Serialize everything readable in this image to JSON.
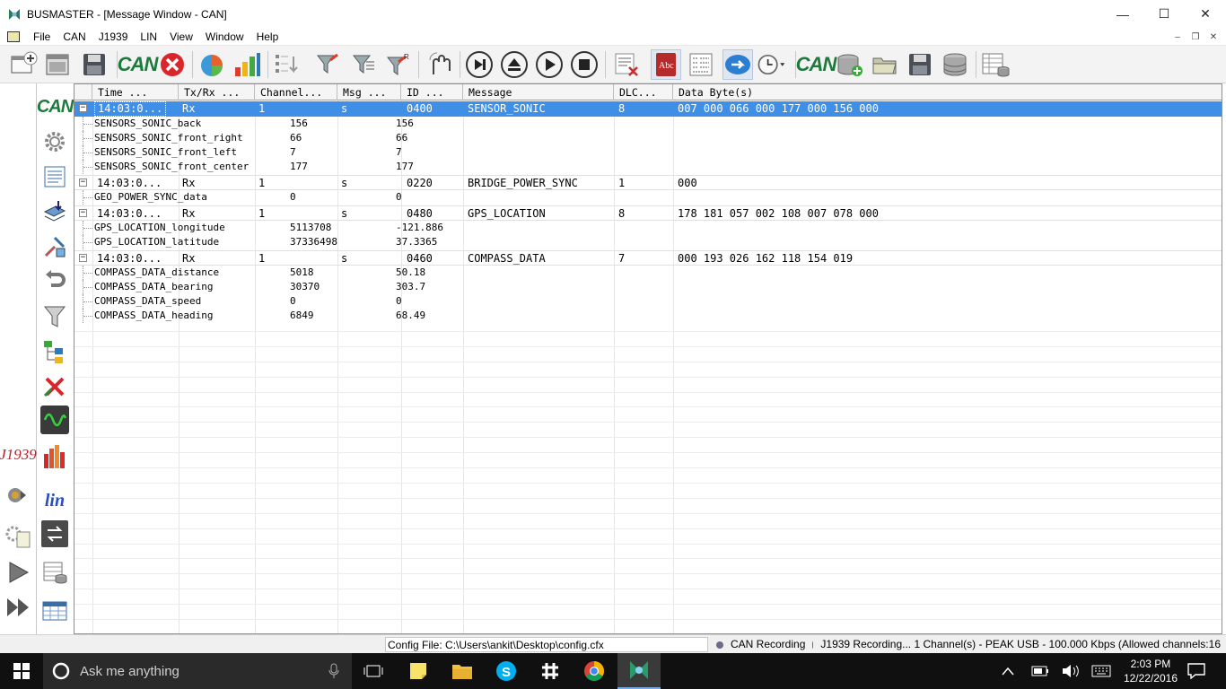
{
  "window": {
    "title": "BUSMASTER - [Message Window - CAN]",
    "minimize": "—",
    "maximize": "☐",
    "close": "✕"
  },
  "menu": [
    "File",
    "CAN",
    "J1939",
    "LIN",
    "View",
    "Window",
    "Help"
  ],
  "mdi_buttons": [
    "–",
    "❐",
    "✕"
  ],
  "toolbar": {
    "can_label_1": "CAN",
    "can_label_2": "CAN",
    "spell_label": "Abc",
    "filter_r_label": "R"
  },
  "sidebar": {
    "can_label": "CAN",
    "j1939_label": "J1939",
    "lin_label": "lin"
  },
  "columns": [
    "Time   ...",
    "Tx/Rx  ...",
    "Channel...",
    "Msg ...",
    "ID   ...",
    "Message",
    "DLC...",
    "Data Byte(s)"
  ],
  "messages": [
    {
      "time": "14:03:0...",
      "txrx": "Rx",
      "channel": "1",
      "type": "s",
      "id": "0400",
      "name": "SENSOR_SONIC",
      "dlc": "8",
      "data": "007 000 066 000 177 000 156 000",
      "selected": true,
      "signals": [
        {
          "name": "SENSORS_SONIC_back",
          "raw": "156",
          "phys": "156"
        },
        {
          "name": "SENSORS_SONIC_front_right",
          "raw": "66",
          "phys": "66"
        },
        {
          "name": "SENSORS_SONIC_front_left",
          "raw": "7",
          "phys": "7"
        },
        {
          "name": "SENSORS_SONIC_front_center",
          "raw": "177",
          "phys": "177"
        }
      ]
    },
    {
      "time": "14:03:0...",
      "txrx": "Rx",
      "channel": "1",
      "type": "s",
      "id": "0220",
      "name": "BRIDGE_POWER_SYNC",
      "dlc": "1",
      "data": "000",
      "selected": false,
      "signals": [
        {
          "name": "GEO_POWER_SYNC_data",
          "raw": "0",
          "phys": "0"
        }
      ]
    },
    {
      "time": "14:03:0...",
      "txrx": "Rx",
      "channel": "1",
      "type": "s",
      "id": "0480",
      "name": "GPS_LOCATION",
      "dlc": "8",
      "data": "178 181 057 002 108 007 078 000",
      "selected": false,
      "signals": [
        {
          "name": "GPS_LOCATION_longitude",
          "raw": "5113708",
          "phys": "-121.886"
        },
        {
          "name": "GPS_LOCATION_latitude",
          "raw": "37336498",
          "phys": "37.3365"
        }
      ]
    },
    {
      "time": "14:03:0...",
      "txrx": "Rx",
      "channel": "1",
      "type": "s",
      "id": "0460",
      "name": "COMPASS_DATA",
      "dlc": "7",
      "data": "000 193 026 162 118 154 019",
      "selected": false,
      "signals": [
        {
          "name": "COMPASS_DATA_distance",
          "raw": "5018",
          "phys": "50.18"
        },
        {
          "name": "COMPASS_DATA_bearing",
          "raw": "30370",
          "phys": "303.7"
        },
        {
          "name": "COMPASS_DATA_speed",
          "raw": "0",
          "phys": "0"
        },
        {
          "name": "COMPASS_DATA_heading",
          "raw": "6849",
          "phys": "68.49"
        }
      ]
    }
  ],
  "status": {
    "config": "Config File: C:\\Users\\ankit\\Desktop\\config.cfx",
    "can_recording": "CAN Recording",
    "j1939_recording": "J1939 Recording... 1 Channel(s) - PEAK USB - 100.000 Kbps (Allowed channels:16"
  },
  "taskbar": {
    "search_placeholder": "Ask me anything",
    "time": "2:03 PM",
    "date": "12/22/2016"
  },
  "colors": {
    "selection": "#3f8fe6",
    "can_green": "#1d7a3c",
    "taskbar": "#101010"
  }
}
